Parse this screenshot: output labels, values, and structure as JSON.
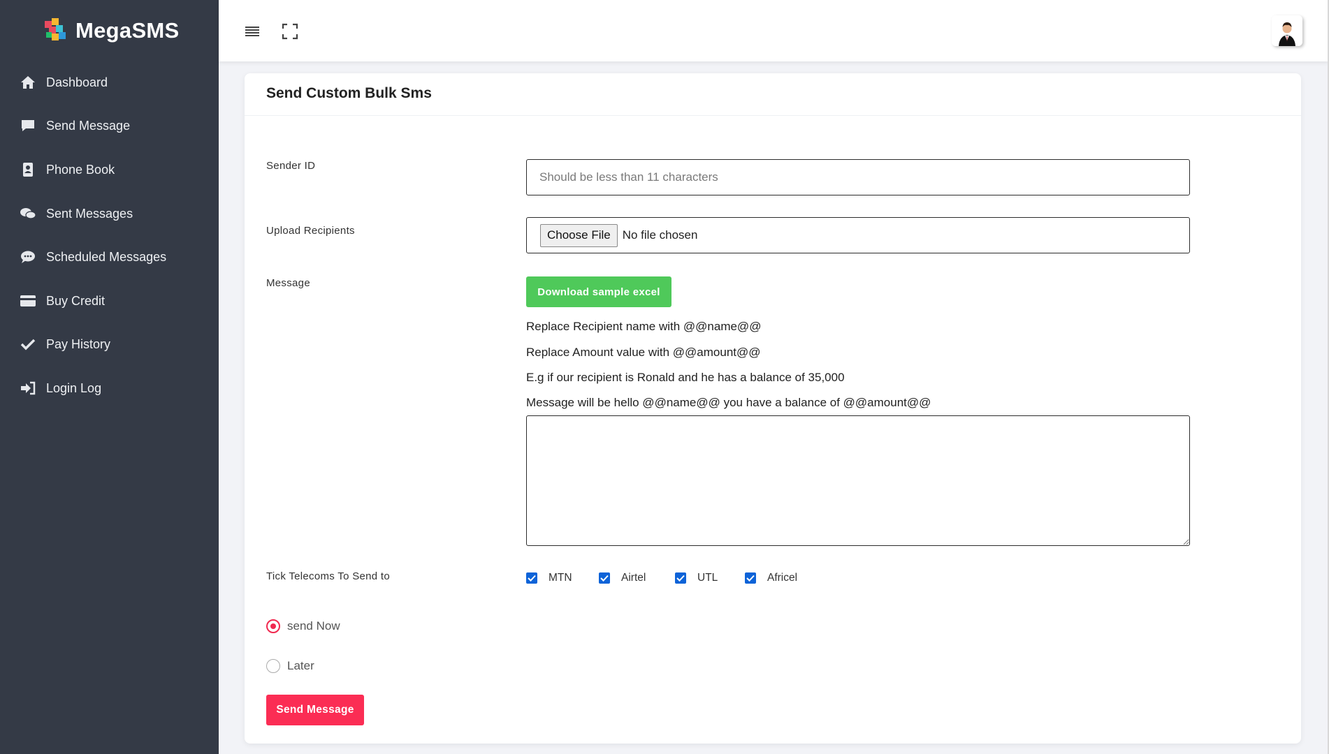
{
  "brand": {
    "name": "MegaSMS"
  },
  "sidebar": {
    "items": [
      {
        "label": "Dashboard",
        "icon": "home-icon"
      },
      {
        "label": "Send Message",
        "icon": "message-icon"
      },
      {
        "label": "Phone Book",
        "icon": "address-book-icon"
      },
      {
        "label": "Sent Messages",
        "icon": "comments-icon"
      },
      {
        "label": "Scheduled Messages",
        "icon": "comment-dots-icon"
      },
      {
        "label": "Buy Credit",
        "icon": "credit-card-icon"
      },
      {
        "label": "Pay History",
        "icon": "check-icon"
      },
      {
        "label": "Login Log",
        "icon": "sign-in-icon"
      }
    ]
  },
  "card": {
    "title": "Send Custom Bulk Sms"
  },
  "form": {
    "sender_label": "Sender ID",
    "sender_placeholder": "Should be less than 11 characters",
    "sender_value": "",
    "upload_label": "Upload Recipients",
    "choose_file_label": "Choose File",
    "no_file_text": "No file chosen",
    "message_label": "Message",
    "download_label": "Download sample excel",
    "hints": [
      "Replace Recipient name with @@name@@",
      "Replace Amount value with @@amount@@",
      "E.g if our recipient is Ronald and he has a balance of 35,000",
      "Message will be hello @@name@@ you have a balance of @@amount@@"
    ],
    "message_value": "",
    "telecoms_label": "Tick Telecoms To Send to",
    "telecoms": [
      {
        "name": "MTN",
        "checked": true
      },
      {
        "name": "Airtel",
        "checked": true
      },
      {
        "name": "UTL",
        "checked": true
      },
      {
        "name": "Africel",
        "checked": true
      }
    ],
    "schedule": [
      {
        "label": "send Now",
        "selected": true
      },
      {
        "label": "Later",
        "selected": false
      }
    ],
    "submit_label": "Send Message"
  },
  "colors": {
    "sidebar_bg": "#343a46",
    "download_button": "#4fc95a",
    "submit_button": "#fb2d54",
    "checkbox": "#0d63d8",
    "radio_accent": "#f0294f"
  }
}
